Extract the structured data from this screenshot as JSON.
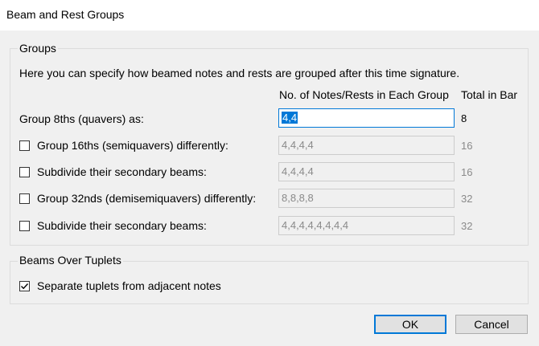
{
  "window": {
    "title": "Beam and Rest Groups"
  },
  "groups": {
    "legend": "Groups",
    "description": "Here you can specify how beamed notes and rests are grouped after this time signature.",
    "col_notes": "No. of Notes/Rests in Each Group",
    "col_total": "Total in Bar",
    "rows": [
      {
        "label": "Group 8ths (quavers) as:",
        "value": "4,4",
        "total": "8",
        "has_checkbox": false,
        "enabled": true
      },
      {
        "label": "Group 16ths (semiquavers) differently:",
        "value": "4,4,4,4",
        "total": "16",
        "has_checkbox": true,
        "checked": false
      },
      {
        "label": "Subdivide their secondary beams:",
        "value": "4,4,4,4",
        "total": "16",
        "has_checkbox": true,
        "checked": false
      },
      {
        "label": "Group 32nds (demisemiquavers) differently:",
        "value": "8,8,8,8",
        "total": "32",
        "has_checkbox": true,
        "checked": false
      },
      {
        "label": "Subdivide their secondary beams:",
        "value": "4,4,4,4,4,4,4,4",
        "total": "32",
        "has_checkbox": true,
        "checked": false
      }
    ]
  },
  "tuplets": {
    "legend": "Beams Over Tuplets",
    "separate_label": "Separate tuplets from adjacent notes",
    "separate_checked": true
  },
  "buttons": {
    "ok": "OK",
    "cancel": "Cancel"
  },
  "colors": {
    "accent": "#0078d7",
    "disabled_text": "#8a8a8a"
  }
}
